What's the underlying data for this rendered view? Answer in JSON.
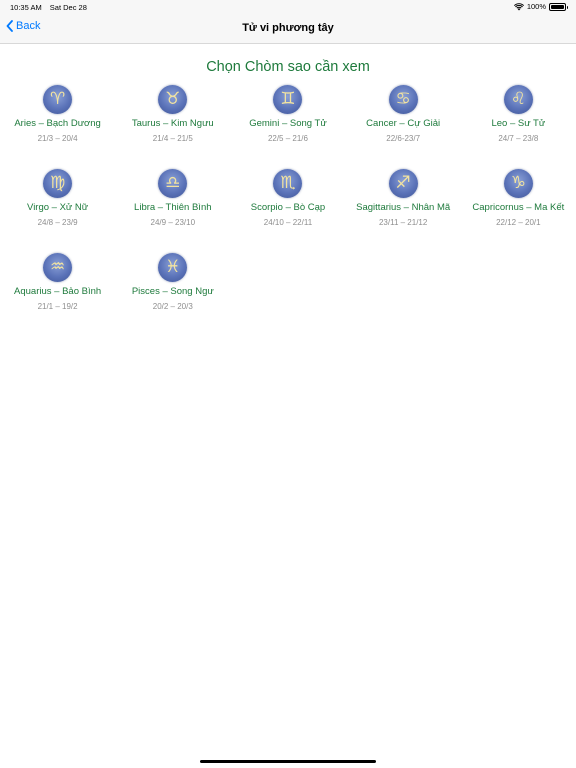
{
  "status_bar": {
    "time": "10:35 AM",
    "date": "Sat Dec 28",
    "battery": "100%"
  },
  "nav": {
    "back_label": "Back",
    "title": "Tử vi phương tây"
  },
  "heading": "Chọn Chòm sao cần xem",
  "signs": [
    {
      "glyph": "♈",
      "name": "Aries – Bạch Dương",
      "dates": "21/3 – 20/4"
    },
    {
      "glyph": "♉",
      "name": "Taurus – Kim Ngưu",
      "dates": "21/4 – 21/5"
    },
    {
      "glyph": "♊",
      "name": "Gemini – Song Tử",
      "dates": "22/5 – 21/6"
    },
    {
      "glyph": "♋",
      "name": "Cancer – Cự Giải",
      "dates": "22/6-23/7"
    },
    {
      "glyph": "♌",
      "name": "Leo – Sư Tử",
      "dates": "24/7 – 23/8"
    },
    {
      "glyph": "♍",
      "name": "Virgo – Xử Nữ",
      "dates": "24/8 – 23/9"
    },
    {
      "glyph": "♎",
      "name": "Libra – Thiên Bình",
      "dates": "24/9 – 23/10"
    },
    {
      "glyph": "♏",
      "name": "Scorpio – Bò Cạp",
      "dates": "24/10 – 22/11"
    },
    {
      "glyph": "♐",
      "name": "Sagittarius – Nhân Mã",
      "dates": "23/11 – 21/12"
    },
    {
      "glyph": "♑",
      "name": "Capricornus – Ma Kết",
      "dates": "22/12 – 20/1"
    },
    {
      "glyph": "♒",
      "name": "Aquarius – Bảo Bình",
      "dates": "21/1 – 19/2"
    },
    {
      "glyph": "♓",
      "name": "Pisces – Song Ngư",
      "dates": "20/2 – 20/3"
    }
  ]
}
